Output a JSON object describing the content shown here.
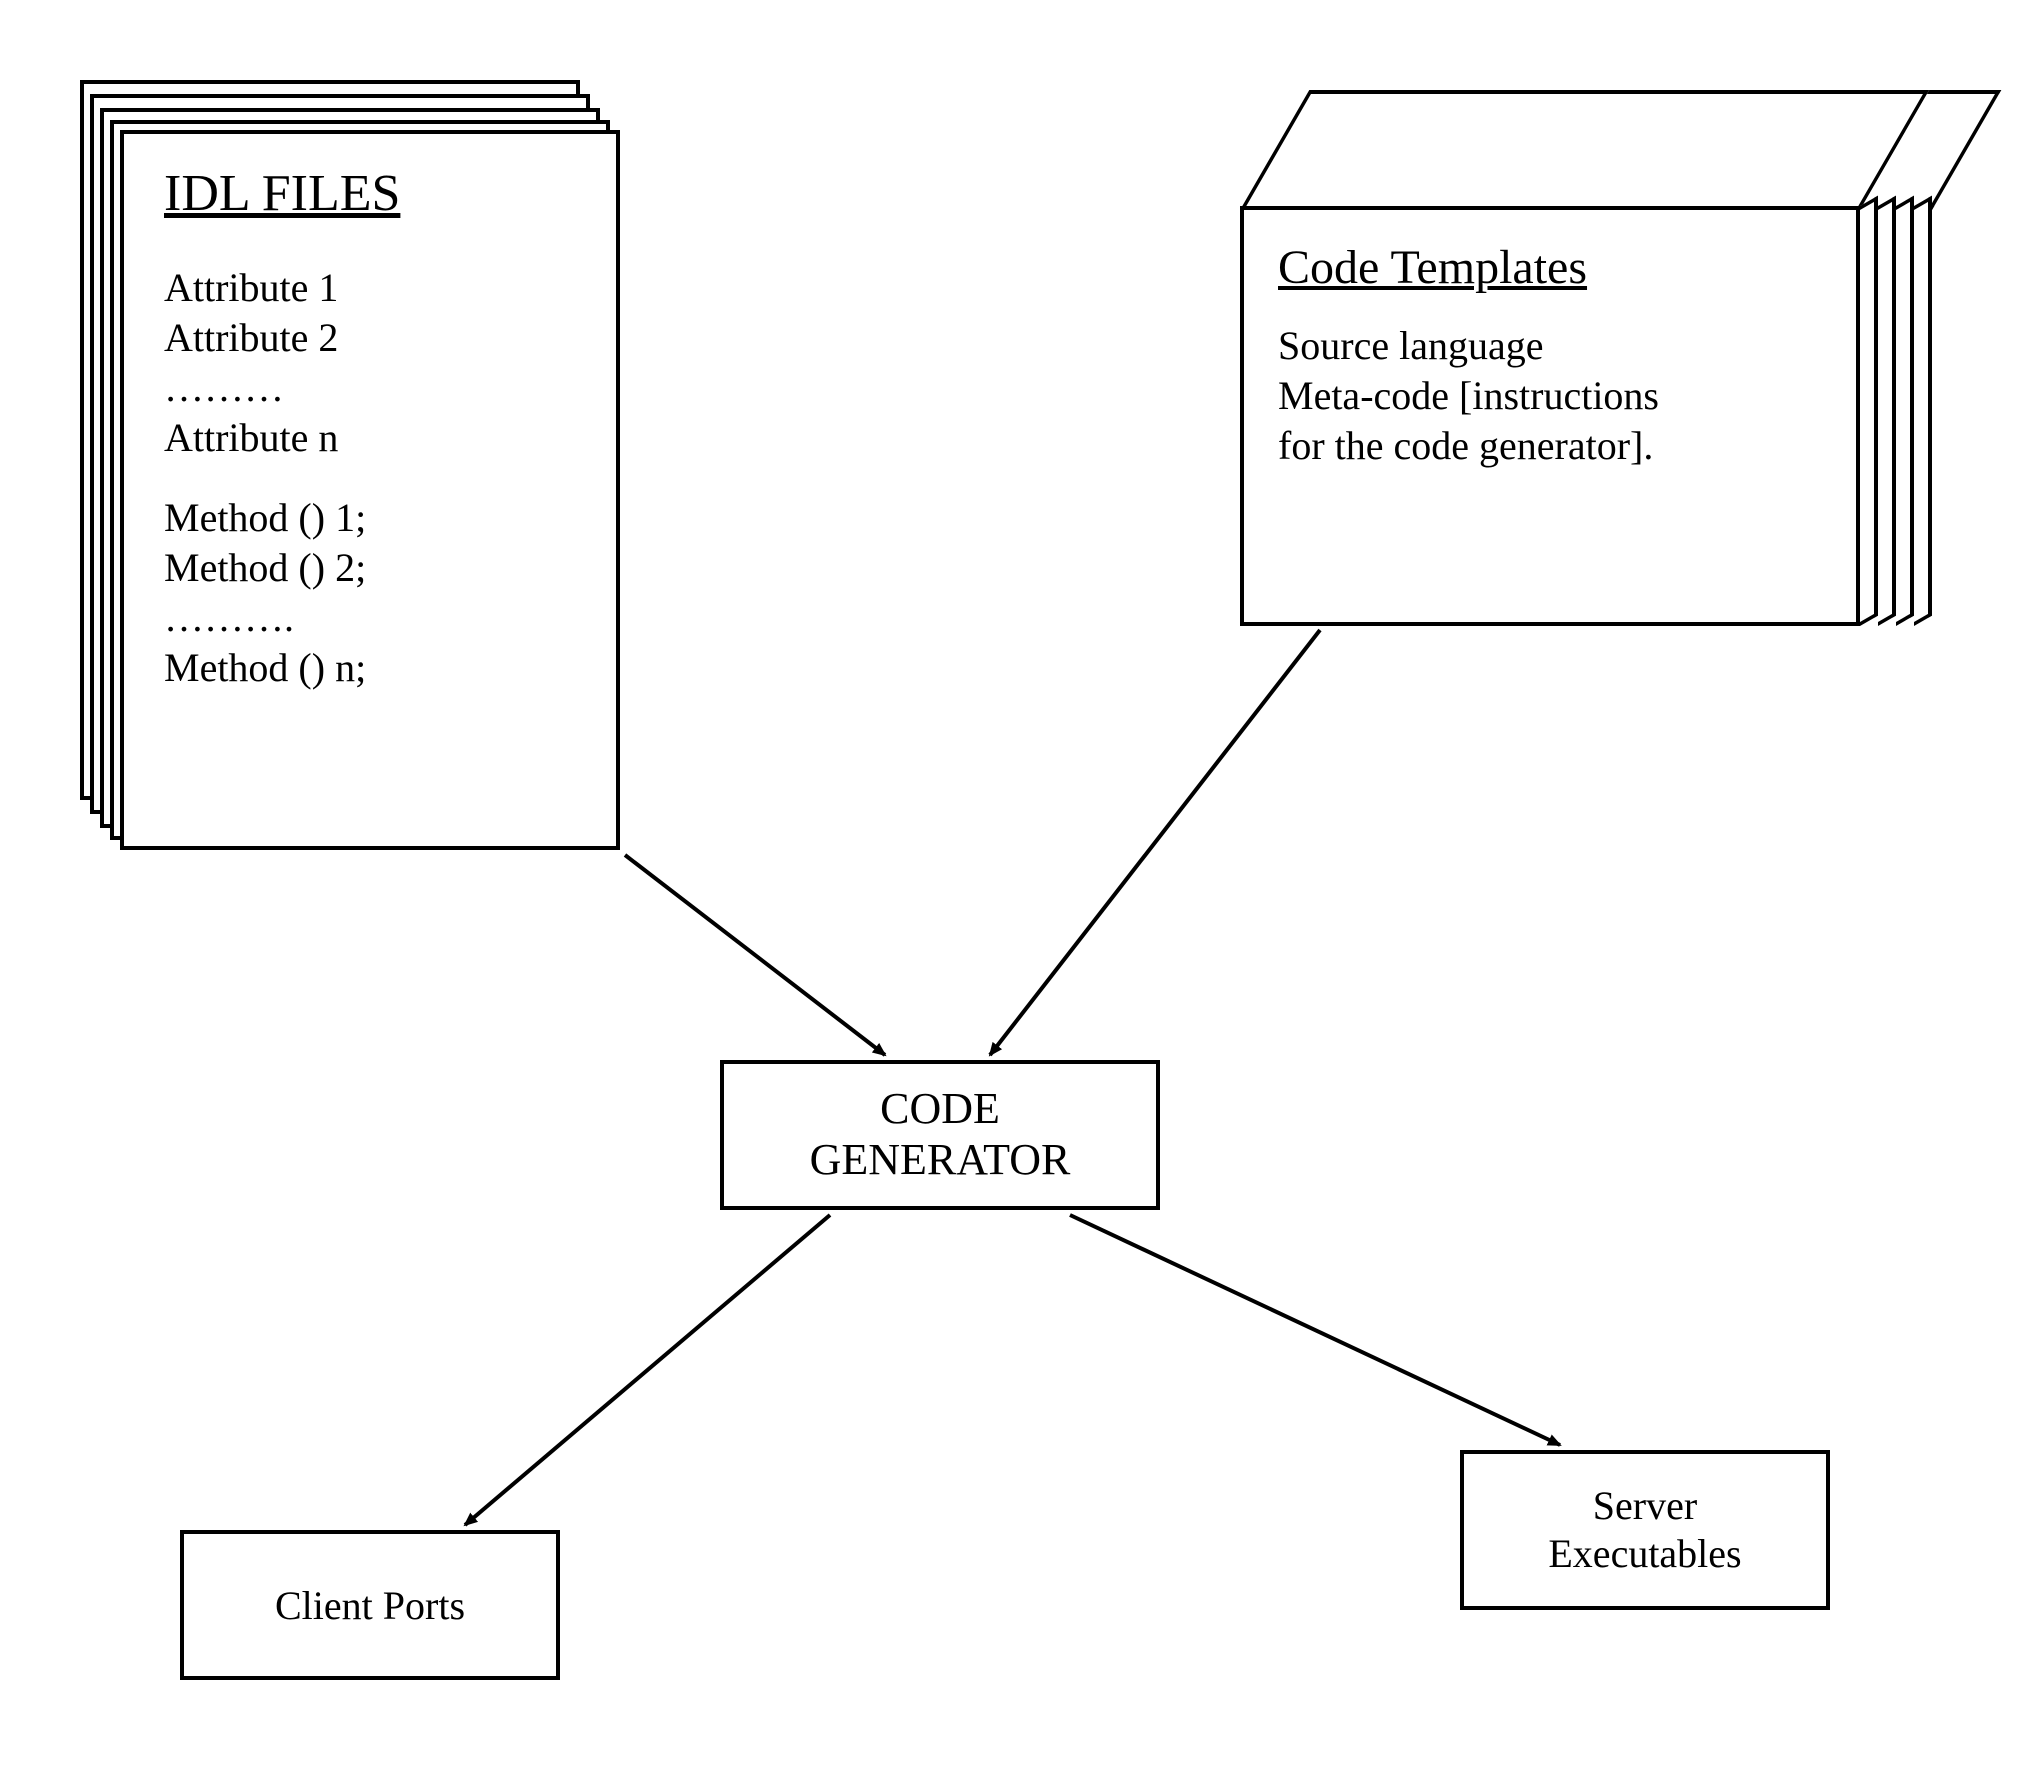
{
  "idl": {
    "title": "IDL FILES",
    "lines": [
      "Attribute 1",
      "Attribute 2",
      "………",
      "Attribute n",
      "",
      "Method () 1;",
      "Method () 2;",
      "……….",
      "Method () n;"
    ]
  },
  "code_templates": {
    "title": "Code Templates",
    "lines": [
      "Source language",
      "Meta-code [instructions",
      "for the code generator]."
    ]
  },
  "generator": {
    "line1": "CODE",
    "line2": "GENERATOR"
  },
  "client": {
    "label": "Client Ports"
  },
  "server": {
    "line1": "Server",
    "line2": "Executables"
  }
}
